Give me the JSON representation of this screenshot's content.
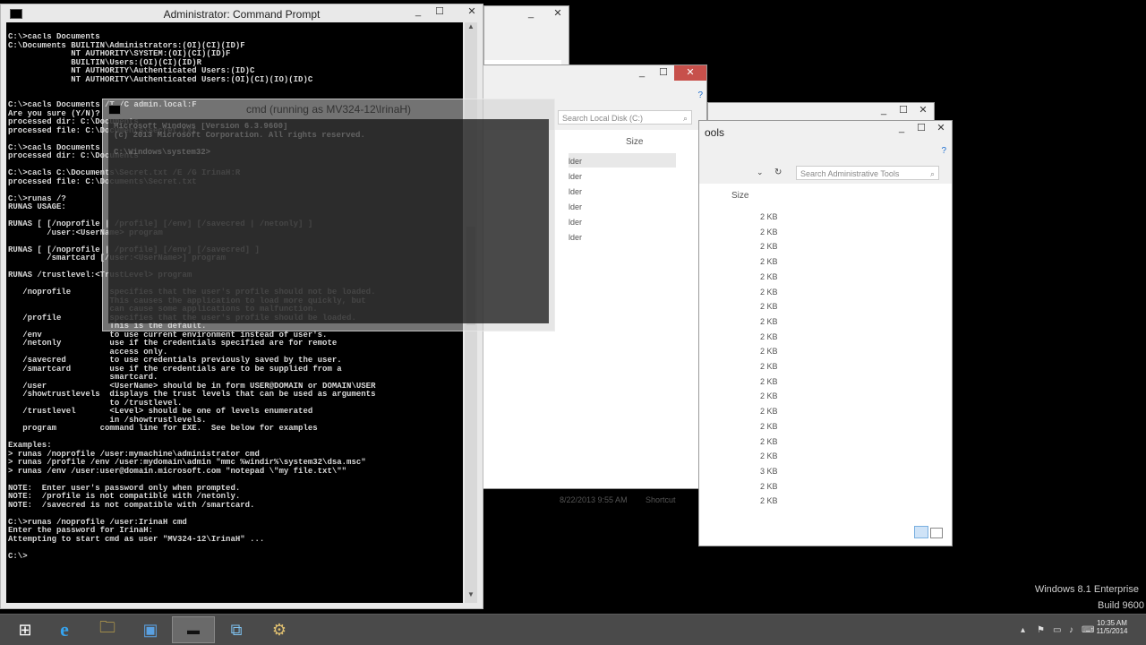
{
  "cmd_admin": {
    "title": "Administrator: Command Prompt",
    "lines": [
      "C:\\>cacls Documents",
      "C:\\Documents BUILTIN\\Administrators:(OI)(CI)(ID)F",
      "             NT AUTHORITY\\SYSTEM:(OI)(CI)(ID)F",
      "             BUILTIN\\Users:(OI)(CI)(ID)R",
      "             NT AUTHORITY\\Authenticated Users:(ID)C",
      "             NT AUTHORITY\\Authenticated Users:(OI)(CI)(IO)(ID)C",
      "",
      "",
      "C:\\>cacls Documents /T /C admin.local:F",
      "Are you sure (Y/N)?",
      "processed dir: C:\\Documents",
      "processed file: C:\\Documents\\secret.txt",
      "",
      "C:\\>cacls Documents",
      "processed dir: C:\\Documents",
      "",
      "C:\\>cacls C:\\Documents\\Secret.txt /E /G IrinaH:R",
      "processed file: C:\\Documents\\Secret.txt",
      "",
      "C:\\>runas /?",
      "RUNAS USAGE:",
      "",
      "RUNAS [ [/noprofile | /profile] [/env] [/savecred | /netonly] ]",
      "        /user:<UserName> program",
      "",
      "RUNAS [ [/noprofile | /profile] [/env] [/savecred] ]",
      "        /smartcard [/user:<UserName>] program",
      "",
      "RUNAS /trustlevel:<TrustLevel> program",
      "",
      "   /noprofile        specifies that the user's profile should not be loaded.",
      "                     This causes the application to load more quickly, but",
      "                     can cause some applications to malfunction.",
      "   /profile          specifies that the user's profile should be loaded.",
      "                     This is the default.",
      "   /env              to use current environment instead of user's.",
      "   /netonly          use if the credentials specified are for remote",
      "                     access only.",
      "   /savecred         to use credentials previously saved by the user.",
      "   /smartcard        use if the credentials are to be supplied from a",
      "                     smartcard.",
      "   /user             <UserName> should be in form USER@DOMAIN or DOMAIN\\USER",
      "   /showtrustlevels  displays the trust levels that can be used as arguments",
      "                     to /trustlevel.",
      "   /trustlevel       <Level> should be one of levels enumerated",
      "                     in /showtrustlevels.",
      "   program         command line for EXE.  See below for examples",
      "",
      "Examples:",
      "> runas /noprofile /user:mymachine\\administrator cmd",
      "> runas /profile /env /user:mydomain\\admin \"mmc %windir%\\system32\\dsa.msc\"",
      "> runas /env /user:user@domain.microsoft.com \"notepad \\\"my file.txt\\\"\"",
      "",
      "NOTE:  Enter user's password only when prompted.",
      "NOTE:  /profile is not compatible with /netonly.",
      "NOTE:  /savecred is not compatible with /smartcard.",
      "",
      "C:\\>runas /noprofile /user:IrinaH cmd",
      "Enter the password for IrinaH:",
      "Attempting to start cmd as user \"MV324-12\\IrinaH\" ...",
      "",
      "C:\\>"
    ]
  },
  "cmd_user": {
    "title": "cmd (running as MV324-12\\IrinaH)",
    "lines": [
      "Microsoft Windows [Version 6.3.9600]",
      "(c) 2013 Microsoft Corporation. All rights reserved.",
      "",
      "C:\\Windows\\system32>"
    ]
  },
  "explorer_disk": {
    "search_placeholder": "Search Local Disk (C:)",
    "size_header": "Size",
    "folder_rows": [
      "lder",
      "lder",
      "lder",
      "lder",
      "lder",
      "lder"
    ]
  },
  "explorer_admin": {
    "title_fragment": "ools",
    "search_placeholder": "Search Administrative Tools",
    "size_header": "Size",
    "sizes": [
      "2 KB",
      "2 KB",
      "2 KB",
      "2 KB",
      "2 KB",
      "2 KB",
      "2 KB",
      "2 KB",
      "2 KB",
      "2 KB",
      "2 KB",
      "2 KB",
      "2 KB",
      "2 KB",
      "2 KB",
      "2 KB",
      "2 KB",
      "3 KB",
      "2 KB",
      "2 KB"
    ],
    "footer_date": "8/22/2013 9:55 AM",
    "footer_type": "Shortcut"
  },
  "watermark": {
    "edition": "Windows 8.1 Enterprise",
    "build": "Build 9600"
  },
  "clock": {
    "time": "10:35 AM",
    "date": "11/5/2014"
  },
  "icons": {
    "start": "⊞",
    "ie": "e",
    "folder": "🗀",
    "powershell": "▣",
    "cmd": "▬",
    "network": "⧉",
    "tools": "⚙"
  }
}
